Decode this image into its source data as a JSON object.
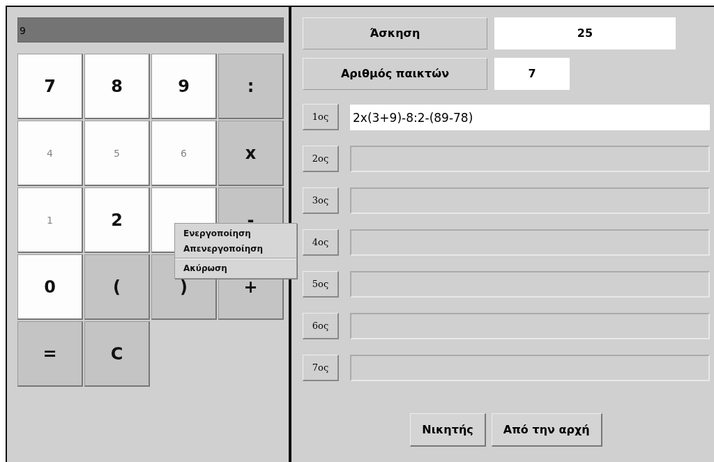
{
  "display": {
    "value": "9"
  },
  "keys": [
    {
      "label": "7",
      "kind": "digit",
      "disabled": false
    },
    {
      "label": "8",
      "kind": "digit",
      "disabled": false
    },
    {
      "label": "9",
      "kind": "digit",
      "disabled": false
    },
    {
      "label": ":",
      "kind": "operator",
      "disabled": false
    },
    {
      "label": "4",
      "kind": "digit",
      "disabled": true
    },
    {
      "label": "5",
      "kind": "digit",
      "disabled": true
    },
    {
      "label": "6",
      "kind": "digit",
      "disabled": true
    },
    {
      "label": "x",
      "kind": "operator",
      "disabled": false
    },
    {
      "label": "1",
      "kind": "digit",
      "disabled": true
    },
    {
      "label": "2",
      "kind": "digit",
      "disabled": false
    },
    {
      "kind": "digit"
    },
    {
      "label": "-",
      "kind": "operator",
      "disabled": false
    },
    {
      "label": "0",
      "kind": "digit",
      "disabled": false
    },
    {
      "label": "(",
      "kind": "operator",
      "disabled": false
    },
    {
      "label": ")",
      "kind": "operator",
      "disabled": false
    },
    {
      "label": "+",
      "kind": "operator",
      "disabled": false
    },
    {
      "label": "=",
      "kind": "operator",
      "disabled": false
    },
    {
      "label": "C",
      "kind": "operator",
      "disabled": false
    }
  ],
  "context_menu": {
    "items": [
      {
        "label": "Ενεργοποίηση",
        "separator_before": false
      },
      {
        "label": "Απενεργοποίηση",
        "separator_before": false
      },
      {
        "label": "Ακύρωση",
        "separator_before": true
      }
    ]
  },
  "exercise": {
    "label": "Άσκηση",
    "value": "25"
  },
  "players_count": {
    "label": "Αριθμός παικτών",
    "value": "7"
  },
  "players": [
    {
      "label": "1ος",
      "value": "2x(3+9)-8:2-(89-78)",
      "disabled": false
    },
    {
      "label": "2ος",
      "disabled": true
    },
    {
      "label": "3ος",
      "disabled": true
    },
    {
      "label": "4ος",
      "disabled": true
    },
    {
      "label": "5ος",
      "disabled": true
    },
    {
      "label": "6ος",
      "disabled": true
    },
    {
      "label": "7ος",
      "disabled": true
    }
  ],
  "buttons": [
    {
      "label": "Νικητής"
    },
    {
      "label": "Από την αρχή"
    }
  ]
}
